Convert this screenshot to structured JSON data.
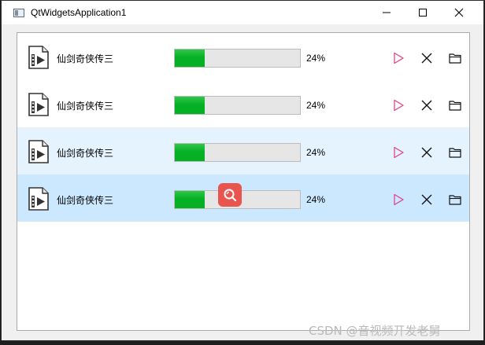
{
  "window": {
    "title": "QtWidgetsApplication1",
    "controls": [
      "minimize",
      "maximize",
      "close"
    ]
  },
  "colors": {
    "progress_fill": "#06b025",
    "play_accent": "#e0458e",
    "row_hover": "#e5f3ff",
    "row_selected": "#cce8ff",
    "badge": "#e9554e"
  },
  "items": [
    {
      "name": "仙剑奇侠传三",
      "percent_label": "24%",
      "progress": 0.24,
      "state": "normal"
    },
    {
      "name": "仙剑奇侠传三",
      "percent_label": "24%",
      "progress": 0.24,
      "state": "normal"
    },
    {
      "name": "仙剑奇侠传三",
      "percent_label": "24%",
      "progress": 0.24,
      "state": "hover"
    },
    {
      "name": "仙剑奇侠传三",
      "percent_label": "24%",
      "progress": 0.24,
      "state": "selected"
    }
  ],
  "icons": {
    "file": "video-file-icon",
    "play": "play-icon",
    "remove": "close-icon",
    "open": "folder-icon",
    "overlay": "search-icon"
  },
  "watermark": "CSDN @音视频开发老舅"
}
